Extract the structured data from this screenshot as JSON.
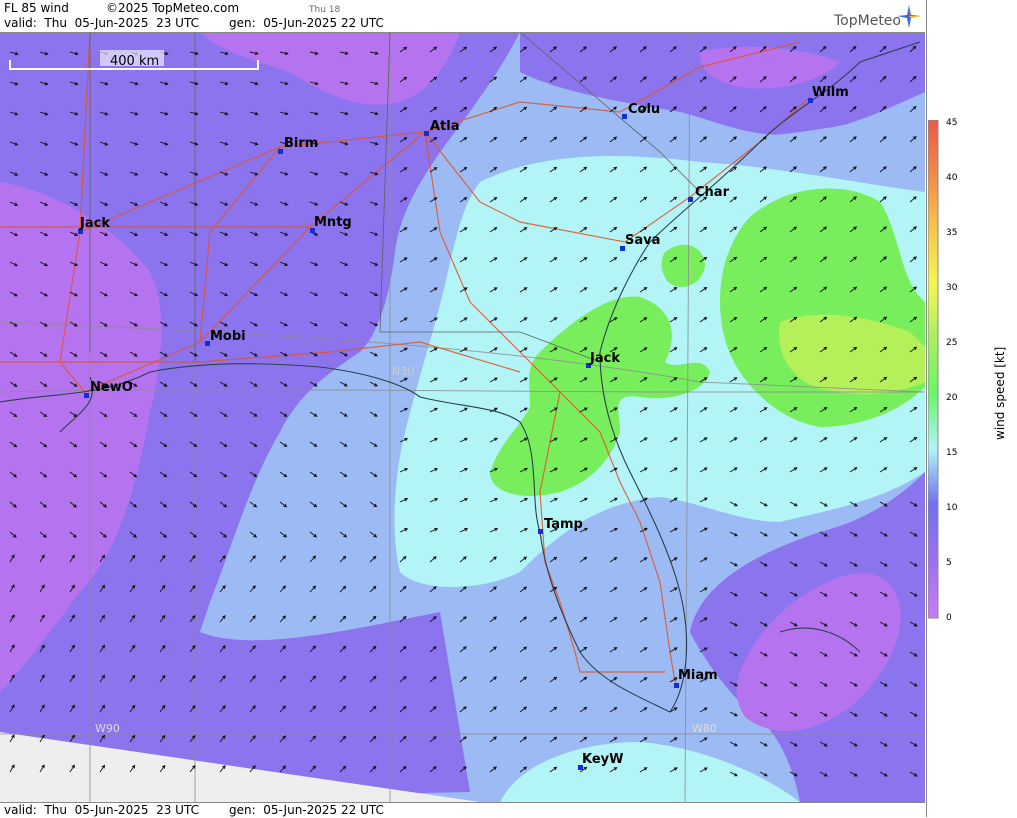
{
  "header": {
    "product": "FL 85 wind",
    "copyright": "©2025 TopMeteo.com",
    "small_day": "Thu 18",
    "valid": "valid:  Thu  05-Jun-2025  23 UTC",
    "gen": "gen:  05-Jun-2025 22 UTC",
    "brand": "TopMeteo"
  },
  "footer": {
    "valid": "valid:  Thu  05-Jun-2025  23 UTC",
    "gen": "gen:  05-Jun-2025 22 UTC"
  },
  "scale_bar": {
    "label": "400 km"
  },
  "gridlabels": {
    "lat": "N30",
    "lon_w90": "W90",
    "lon_w80": "W80"
  },
  "cities": [
    {
      "name": "Wilm"
    },
    {
      "name": "Colu"
    },
    {
      "name": "Atla"
    },
    {
      "name": "Birm"
    },
    {
      "name": "Char"
    },
    {
      "name": "Jack"
    },
    {
      "name": "Mntg"
    },
    {
      "name": "Sava"
    },
    {
      "name": "Mobi"
    },
    {
      "name": "Jack"
    },
    {
      "name": "NewO"
    },
    {
      "name": "Tamp"
    },
    {
      "name": "Miam"
    },
    {
      "name": "KeyW"
    }
  ],
  "legend": {
    "title": "wind speed  [kt]",
    "ticks": [
      "45",
      "40",
      "35",
      "30",
      "25",
      "20",
      "15",
      "10",
      "5",
      "0"
    ],
    "colors": {
      "0": "#c77cf2",
      "5": "#9a70f0",
      "10": "#6f72ee",
      "12": "#88aaf0",
      "15": "#b0f4f8",
      "20": "#6cf26c",
      "25": "#a8f060",
      "30": "#f5f554",
      "35": "#f5c84c",
      "40": "#f28a4a",
      "45": "#e85a4a"
    }
  },
  "colors": {
    "purple": "#b673f0",
    "violet": "#8b74ee",
    "lightblue": "#9cbaf4",
    "cyan": "#b3f4f7",
    "green": "#78ee5c",
    "yellowgreen": "#b5f05a",
    "road": "#e0542a",
    "coast": "#2a4050"
  }
}
